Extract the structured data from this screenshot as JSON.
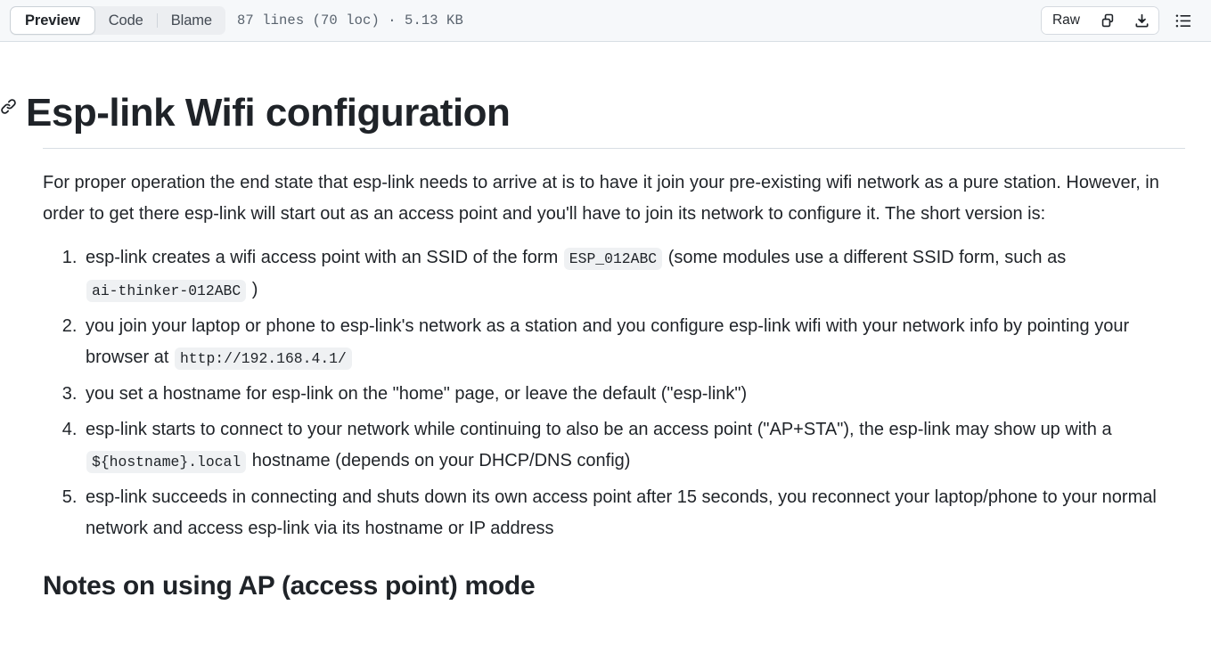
{
  "toolbar": {
    "tabs": [
      {
        "label": "Preview",
        "selected": true
      },
      {
        "label": "Code",
        "selected": false
      },
      {
        "label": "Blame",
        "selected": false
      }
    ],
    "file_meta": "87 lines (70 loc) · 5.13 KB",
    "raw_label": "Raw",
    "copy_icon": "copy-icon",
    "download_icon": "download-icon",
    "toc_icon": "table-of-contents-icon"
  },
  "document": {
    "anchor_icon": "link-icon",
    "title": "Esp-link Wifi configuration",
    "intro": "For proper operation the end state that esp-link needs to arrive at is to have it join your pre-existing wifi network as a pure station. However, in order to get there esp-link will start out as an access point and you'll have to join its network to configure it. The short version is:",
    "list": [
      {
        "parts": [
          {
            "type": "text",
            "value": "esp-link creates a wifi access point with an SSID of the form "
          },
          {
            "type": "code",
            "value": "ESP_012ABC"
          },
          {
            "type": "text",
            "value": " (some modules use a different SSID form, such as "
          },
          {
            "type": "code",
            "value": "ai-thinker-012ABC"
          },
          {
            "type": "text",
            "value": " )"
          }
        ]
      },
      {
        "parts": [
          {
            "type": "text",
            "value": "you join your laptop or phone to esp-link's network as a station and you configure esp-link wifi with your network info by pointing your browser at "
          },
          {
            "type": "code",
            "value": "http://192.168.4.1/"
          }
        ]
      },
      {
        "parts": [
          {
            "type": "text",
            "value": "you set a hostname for esp-link on the \"home\" page, or leave the default (\"esp-link\")"
          }
        ]
      },
      {
        "parts": [
          {
            "type": "text",
            "value": "esp-link starts to connect to your network while continuing to also be an access point (\"AP+STA\"), the esp-link may show up with a "
          },
          {
            "type": "code",
            "value": "${hostname}.local"
          },
          {
            "type": "text",
            "value": " hostname (depends on your DHCP/DNS config)"
          }
        ]
      },
      {
        "parts": [
          {
            "type": "text",
            "value": "esp-link succeeds in connecting and shuts down its own access point after 15 seconds, you reconnect your laptop/phone to your normal network and access esp-link via its hostname or IP address"
          }
        ]
      }
    ],
    "section_heading": "Notes on using AP (access point) mode"
  },
  "colors": {
    "header_bg": "#f6f8fa",
    "border": "#d8dee4",
    "text": "#1f2328",
    "muted": "#59636e",
    "code_bg": "#eff1f3",
    "segment_bg": "#eceef1"
  }
}
